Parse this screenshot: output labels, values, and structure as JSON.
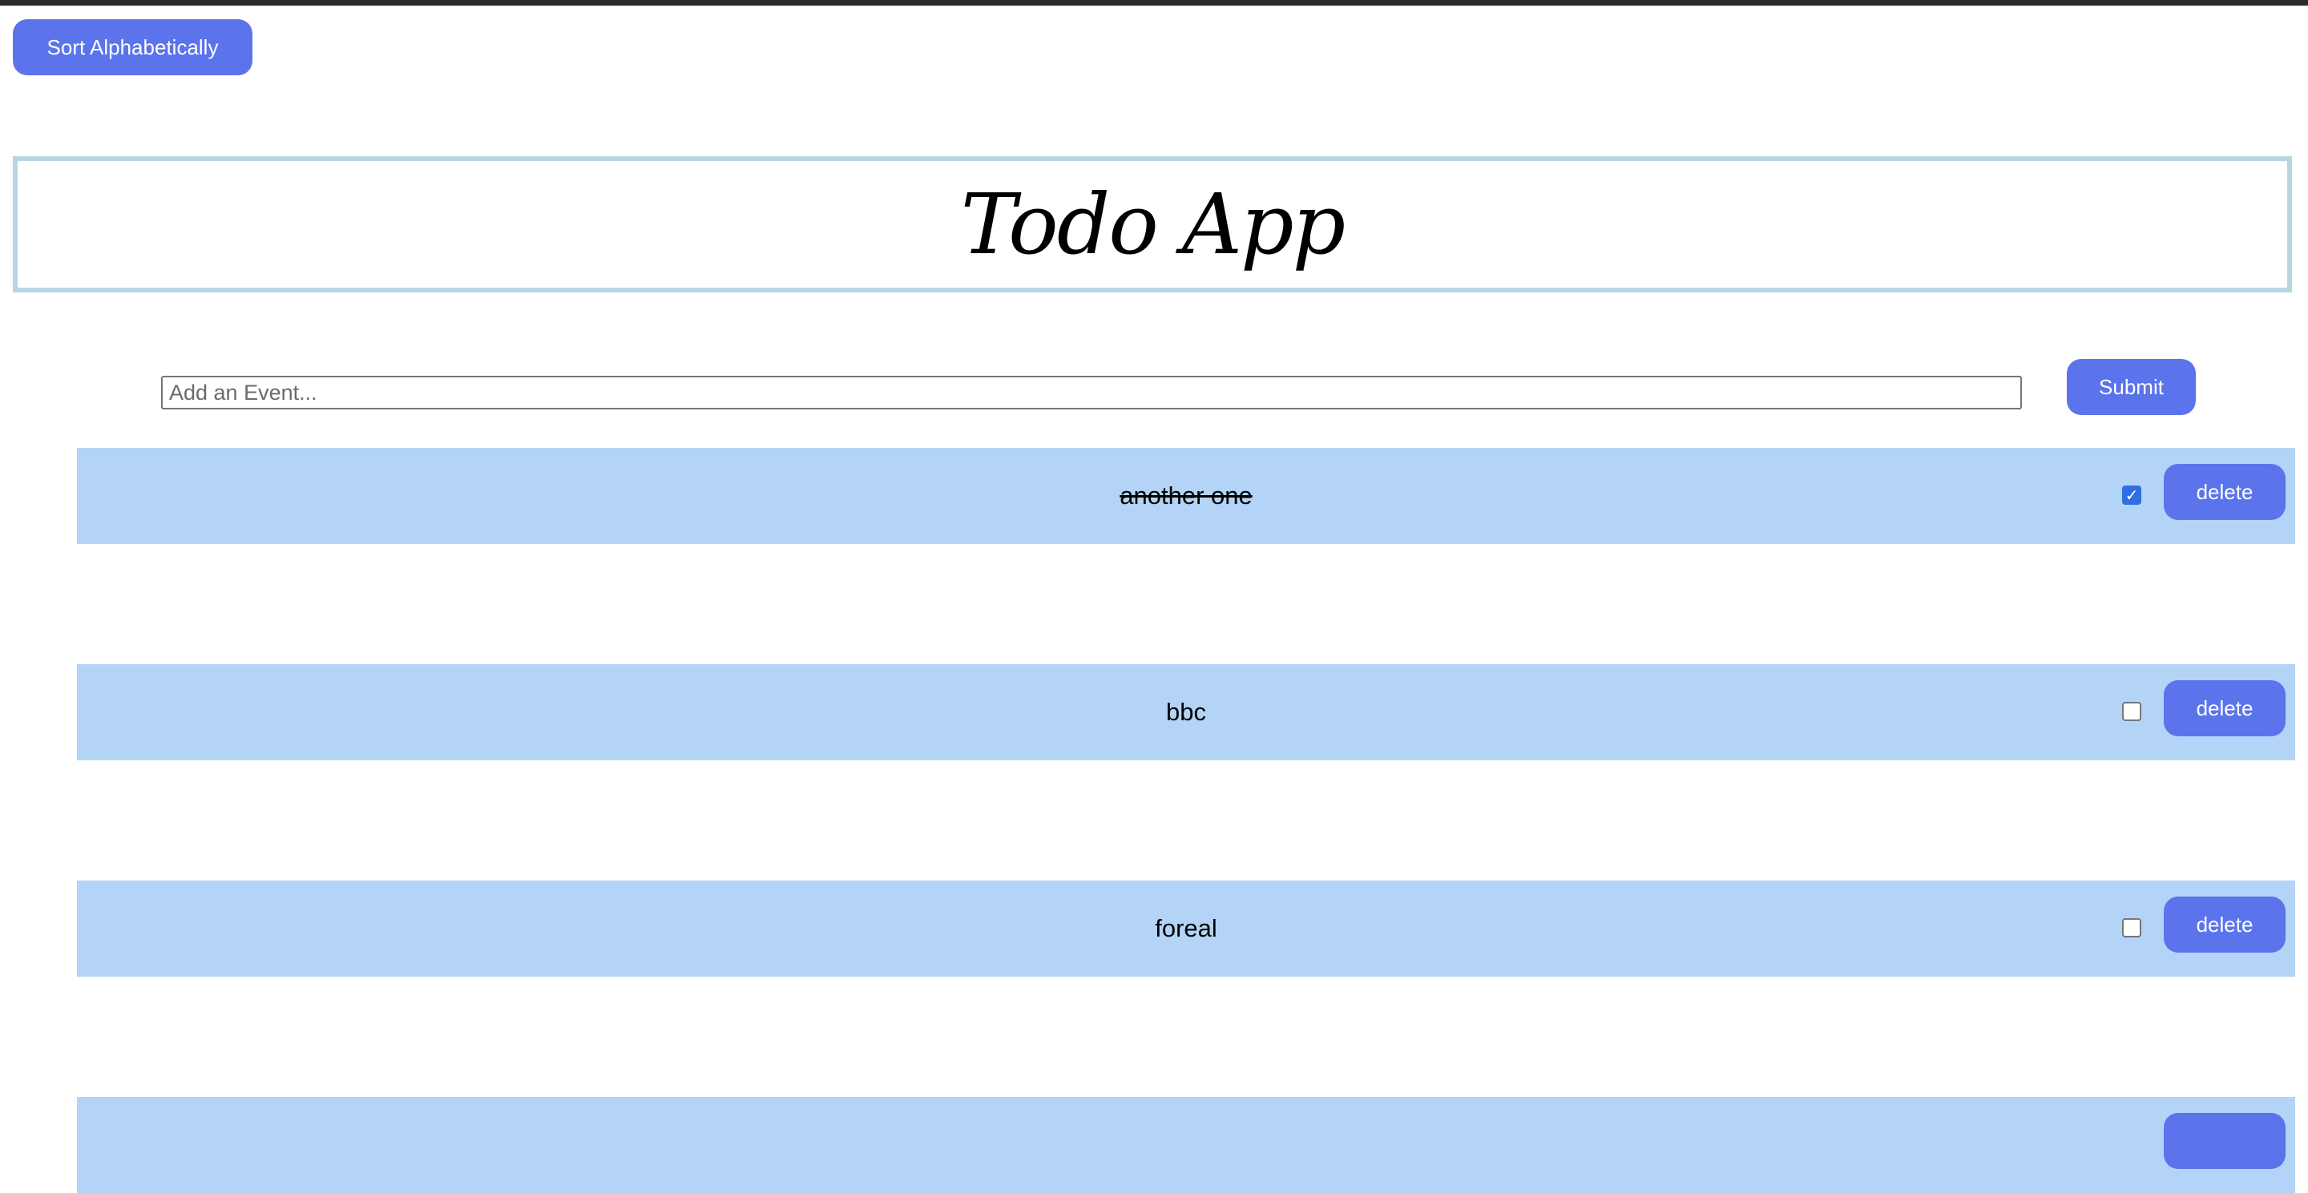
{
  "toolbar": {
    "sort_label": "Sort Alphabetically"
  },
  "header": {
    "title": "Todo App"
  },
  "form": {
    "placeholder": "Add an Event...",
    "value": "",
    "submit_label": "Submit"
  },
  "todos": [
    {
      "text": "another one",
      "completed": true,
      "delete_label": "delete"
    },
    {
      "text": "bbc",
      "completed": false,
      "delete_label": "delete"
    },
    {
      "text": "foreal",
      "completed": false,
      "delete_label": "delete"
    },
    {
      "text": "",
      "completed": false,
      "delete_label": ""
    }
  ],
  "colors": {
    "button": "#5b74ec",
    "row_background": "#b3d4f6",
    "header_border": "#b7d6e2",
    "checkbox_checked": "#2f6fe0"
  }
}
